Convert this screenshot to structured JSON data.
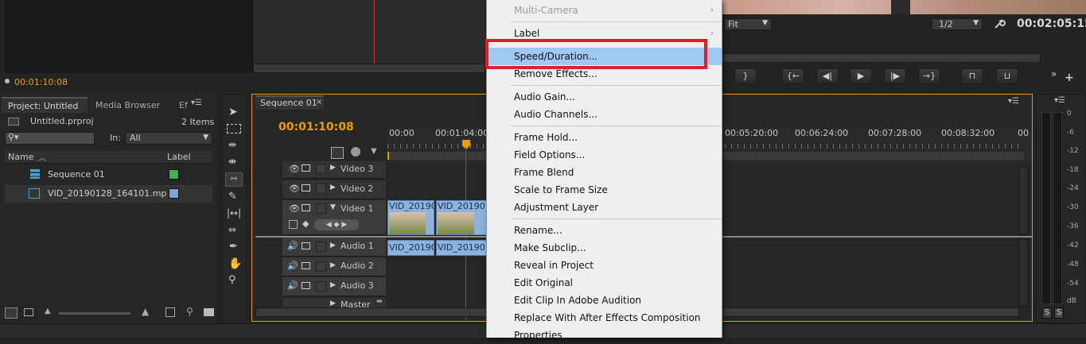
{
  "source_monitor": {
    "timecode": "00:01:10:08"
  },
  "program_monitor": {
    "zoom": "Fit",
    "resolution": "1/2",
    "timecode": "00:02:05:15"
  },
  "project_panel": {
    "tabs": [
      "Project: Untitled",
      "Media Browser",
      "Ef"
    ],
    "file_name": "Untitled.prproj",
    "item_count": "2 Items",
    "search_placeholder": "",
    "in_label": "In:",
    "in_value": "All",
    "columns": {
      "name": "Name",
      "label": "Label"
    },
    "items": [
      {
        "name": "Sequence 01",
        "label_color": "#3cb44b"
      },
      {
        "name": "VID_20190128_164101.mp",
        "label_color": "#7da3d9"
      }
    ]
  },
  "timeline": {
    "tab": "Sequence 01",
    "timecode": "00:01:10:08",
    "ruler": [
      "00:00",
      "00:01:04:00",
      "00:05:20:00",
      "00:06:24:00",
      "00:07:28:00",
      "00:08:32:00",
      "00"
    ],
    "video_tracks": [
      "Video 3",
      "Video 2",
      "Video 1"
    ],
    "audio_tracks": [
      "Audio 1",
      "Audio 2",
      "Audio 3"
    ],
    "master": "Master",
    "clips": {
      "v1a": "VID_20190",
      "v1b": "VID_20190",
      "a1a": "VID_20190",
      "a1b": "VID_20190"
    }
  },
  "meters": {
    "labels": [
      "0",
      "-6",
      "-12",
      "-18",
      "-24",
      "-30",
      "-36",
      "-42",
      "-48",
      "-54",
      "dB"
    ],
    "solo": [
      "S",
      "S"
    ]
  },
  "context_menu": {
    "items": [
      {
        "label": "Multi-Camera",
        "disabled": true,
        "submenu": true
      },
      {
        "label": "Label",
        "submenu": true
      },
      {
        "label": "Speed/Duration...",
        "highlighted": true
      },
      {
        "label": "Remove Effects..."
      },
      {
        "label": "Audio Gain..."
      },
      {
        "label": "Audio Channels..."
      },
      {
        "label": "Frame Hold..."
      },
      {
        "label": "Field Options..."
      },
      {
        "label": "Frame Blend"
      },
      {
        "label": "Scale to Frame Size"
      },
      {
        "label": "Adjustment Layer"
      },
      {
        "label": "Rename..."
      },
      {
        "label": "Make Subclip..."
      },
      {
        "label": "Reveal in Project"
      },
      {
        "label": "Edit Original"
      },
      {
        "label": "Edit Clip In Adobe Audition"
      },
      {
        "label": "Replace With After Effects Composition"
      },
      {
        "label": "Properties"
      }
    ]
  }
}
